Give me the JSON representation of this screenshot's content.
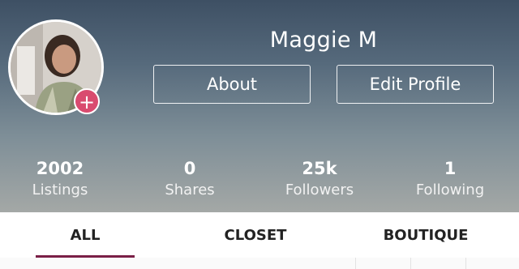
{
  "profile": {
    "name": "Maggie M",
    "about_label": "About",
    "edit_label": "Edit Profile",
    "add_icon": "+"
  },
  "stats": [
    {
      "value": "2002",
      "label": "Listings"
    },
    {
      "value": "0",
      "label": "Shares"
    },
    {
      "value": "25k",
      "label": "Followers"
    },
    {
      "value": "1",
      "label": "Following"
    }
  ],
  "tabs": [
    {
      "label": "ALL",
      "active": true
    },
    {
      "label": "CLOSET",
      "active": false
    },
    {
      "label": "BOUTIQUE",
      "active": false
    }
  ],
  "colors": {
    "accent": "#7a1f46",
    "badge": "#d94b6f"
  }
}
